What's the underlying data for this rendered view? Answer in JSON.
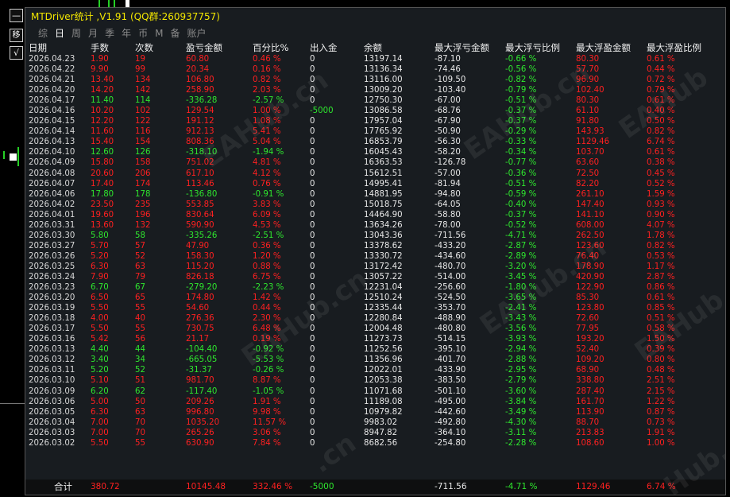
{
  "window": {
    "title": "MTDriver统计 ,V1.91 (QQ群:260937757)",
    "minimize_glyph": "—",
    "move_glyph": "移",
    "check_glyph": "√"
  },
  "tabs": [
    {
      "label": "综",
      "active": false
    },
    {
      "label": "日",
      "active": true
    },
    {
      "label": "周",
      "active": false
    },
    {
      "label": "月",
      "active": false
    },
    {
      "label": "季",
      "active": false
    },
    {
      "label": "年",
      "active": false
    },
    {
      "label": "币",
      "active": false
    },
    {
      "label": "M",
      "active": false
    },
    {
      "label": "备",
      "active": false
    },
    {
      "label": "账户",
      "active": false
    }
  ],
  "columns": [
    "日期",
    "手数",
    "次数",
    "盈亏金额",
    "百分比%",
    "出入金",
    "余额",
    "最大浮亏金额",
    "最大浮亏比例",
    "最大浮盈金额",
    "最大浮盈比例"
  ],
  "colors": {
    "profit": "#ff2020",
    "loss": "#2ee62e",
    "title": "#f2e600",
    "panel": "#181c20"
  },
  "rows": [
    [
      "2026.04.23",
      "1.90",
      "19",
      "60.80",
      "0.46 %",
      "0",
      "13197.14",
      "-87.10",
      "-0.66 %",
      "80.30",
      "0.61 %"
    ],
    [
      "2026.04.22",
      "9.90",
      "99",
      "20.34",
      "0.16 %",
      "0",
      "13136.34",
      "-74.46",
      "-0.56 %",
      "57.70",
      "0.44 %"
    ],
    [
      "2026.04.21",
      "13.40",
      "134",
      "106.80",
      "0.82 %",
      "0",
      "13116.00",
      "-109.50",
      "-0.82 %",
      "96.90",
      "0.72 %"
    ],
    [
      "2026.04.20",
      "14.20",
      "142",
      "258.90",
      "2.03 %",
      "0",
      "13009.20",
      "-103.40",
      "-0.79 %",
      "102.40",
      "0.79 %"
    ],
    [
      "2026.04.17",
      "11.40",
      "114",
      "-336.28",
      "-2.57 %",
      "0",
      "12750.30",
      "-67.00",
      "-0.51 %",
      "80.30",
      "0.61 %"
    ],
    [
      "2026.04.16",
      "10.20",
      "102",
      "129.54",
      "1.00 %",
      "-5000",
      "13086.58",
      "-68.76",
      "-0.37 %",
      "61.10",
      "0.40 %"
    ],
    [
      "2026.04.15",
      "12.20",
      "122",
      "191.12",
      "1.08 %",
      "0",
      "17957.04",
      "-67.90",
      "-0.37 %",
      "91.80",
      "0.50 %"
    ],
    [
      "2026.04.14",
      "11.60",
      "116",
      "912.13",
      "5.41 %",
      "0",
      "17765.92",
      "-50.90",
      "-0.29 %",
      "143.93",
      "0.82 %"
    ],
    [
      "2026.04.13",
      "15.40",
      "154",
      "808.36",
      "5.04 %",
      "0",
      "16853.79",
      "-56.30",
      "-0.33 %",
      "1129.46",
      "6.74 %"
    ],
    [
      "2026.04.10",
      "12.60",
      "126",
      "-318.10",
      "-1.94 %",
      "0",
      "16045.43",
      "-58.20",
      "-0.34 %",
      "103.70",
      "0.61 %"
    ],
    [
      "2026.04.09",
      "15.80",
      "158",
      "751.02",
      "4.81 %",
      "0",
      "16363.53",
      "-126.78",
      "-0.77 %",
      "63.60",
      "0.38 %"
    ],
    [
      "2026.04.08",
      "20.60",
      "206",
      "617.10",
      "4.12 %",
      "0",
      "15612.51",
      "-57.00",
      "-0.36 %",
      "72.50",
      "0.45 %"
    ],
    [
      "2026.04.07",
      "17.40",
      "174",
      "113.46",
      "0.76 %",
      "0",
      "14995.41",
      "-81.94",
      "-0.51 %",
      "82.20",
      "0.52 %"
    ],
    [
      "2026.04.06",
      "17.80",
      "178",
      "-136.80",
      "-0.91 %",
      "0",
      "14881.95",
      "-94.80",
      "-0.59 %",
      "261.10",
      "1.59 %"
    ],
    [
      "2026.04.02",
      "23.50",
      "235",
      "553.85",
      "3.83 %",
      "0",
      "15018.75",
      "-64.05",
      "-0.40 %",
      "147.40",
      "0.93 %"
    ],
    [
      "2026.04.01",
      "19.60",
      "196",
      "830.64",
      "6.09 %",
      "0",
      "14464.90",
      "-58.80",
      "-0.37 %",
      "141.10",
      "0.90 %"
    ],
    [
      "2026.03.31",
      "13.60",
      "132",
      "590.90",
      "4.53 %",
      "0",
      "13634.26",
      "-78.00",
      "-0.52 %",
      "608.00",
      "4.07 %"
    ],
    [
      "2026.03.30",
      "5.80",
      "58",
      "-335.26",
      "-2.51 %",
      "0",
      "13043.36",
      "-711.56",
      "-4.71 %",
      "262.50",
      "1.78 %"
    ],
    [
      "2026.03.27",
      "5.70",
      "57",
      "47.90",
      "0.36 %",
      "0",
      "13378.62",
      "-433.20",
      "-2.87 %",
      "123.60",
      "0.82 %"
    ],
    [
      "2026.03.26",
      "5.20",
      "52",
      "158.30",
      "1.20 %",
      "0",
      "13330.72",
      "-434.60",
      "-2.89 %",
      "76.40",
      "0.53 %"
    ],
    [
      "2026.03.25",
      "6.30",
      "63",
      "115.20",
      "0.88 %",
      "0",
      "13172.42",
      "-480.70",
      "-3.20 %",
      "178.90",
      "1.17 %"
    ],
    [
      "2026.03.24",
      "7.90",
      "79",
      "826.18",
      "6.75 %",
      "0",
      "13057.22",
      "-514.00",
      "-3.45 %",
      "420.90",
      "2.87 %"
    ],
    [
      "2026.03.23",
      "6.70",
      "67",
      "-279.20",
      "-2.23 %",
      "0",
      "12231.04",
      "-256.60",
      "-1.80 %",
      "122.90",
      "0.86 %"
    ],
    [
      "2026.03.20",
      "6.50",
      "65",
      "174.80",
      "1.42 %",
      "0",
      "12510.24",
      "-524.50",
      "-3.65 %",
      "85.30",
      "0.61 %"
    ],
    [
      "2026.03.19",
      "5.50",
      "55",
      "54.60",
      "0.44 %",
      "0",
      "12335.44",
      "-353.70",
      "-2.41 %",
      "123.80",
      "0.85 %"
    ],
    [
      "2026.03.18",
      "4.00",
      "40",
      "276.36",
      "2.30 %",
      "0",
      "12280.84",
      "-488.90",
      "-3.43 %",
      "72.60",
      "0.51 %"
    ],
    [
      "2026.03.17",
      "5.50",
      "55",
      "730.75",
      "6.48 %",
      "0",
      "12004.48",
      "-480.80",
      "-3.56 %",
      "77.95",
      "0.58 %"
    ],
    [
      "2026.03.16",
      "5.42",
      "56",
      "21.17",
      "0.19 %",
      "0",
      "11273.73",
      "-514.15",
      "-3.93 %",
      "193.20",
      "1.50 %"
    ],
    [
      "2026.03.13",
      "4.40",
      "44",
      "-104.40",
      "-0.92 %",
      "0",
      "11252.56",
      "-395.10",
      "-2.94 %",
      "52.40",
      "0.39 %"
    ],
    [
      "2026.03.12",
      "3.40",
      "34",
      "-665.05",
      "-5.53 %",
      "0",
      "11356.96",
      "-401.70",
      "-2.88 %",
      "109.20",
      "0.80 %"
    ],
    [
      "2026.03.11",
      "5.20",
      "52",
      "-31.37",
      "-0.26 %",
      "0",
      "12022.01",
      "-433.90",
      "-2.95 %",
      "68.90",
      "0.48 %"
    ],
    [
      "2026.03.10",
      "5.10",
      "51",
      "981.70",
      "8.87 %",
      "0",
      "12053.38",
      "-383.50",
      "-2.79 %",
      "338.80",
      "2.51 %"
    ],
    [
      "2026.03.09",
      "6.20",
      "62",
      "-117.40",
      "-1.05 %",
      "0",
      "11071.68",
      "-501.10",
      "-3.60 %",
      "287.40",
      "2.15 %"
    ],
    [
      "2026.03.06",
      "5.00",
      "50",
      "209.26",
      "1.91 %",
      "0",
      "11189.08",
      "-495.00",
      "-3.84 %",
      "161.70",
      "1.22 %"
    ],
    [
      "2026.03.05",
      "6.30",
      "63",
      "996.80",
      "9.98 %",
      "0",
      "10979.82",
      "-442.60",
      "-3.49 %",
      "113.90",
      "0.87 %"
    ],
    [
      "2026.03.04",
      "7.00",
      "70",
      "1035.20",
      "11.57 %",
      "0",
      "9983.02",
      "-492.80",
      "-4.30 %",
      "88.70",
      "0.73 %"
    ],
    [
      "2026.03.03",
      "7.00",
      "70",
      "265.26",
      "3.06 %",
      "0",
      "8947.82",
      "-364.10",
      "-3.11 %",
      "213.83",
      "1.91 %"
    ],
    [
      "2026.03.02",
      "5.50",
      "55",
      "630.90",
      "7.84 %",
      "0",
      "8682.56",
      "-254.80",
      "-2.28 %",
      "108.60",
      "1.00 %"
    ]
  ],
  "totals": {
    "label": "合计",
    "lots": "380.72",
    "pnl": "10145.48",
    "pct": "332.46 %",
    "deposit": "-5000",
    "max_float_loss": "-711.56",
    "max_float_loss_pct": "-4.71 %",
    "max_float_profit": "1129.46",
    "max_float_profit_pct": "6.74 %"
  }
}
